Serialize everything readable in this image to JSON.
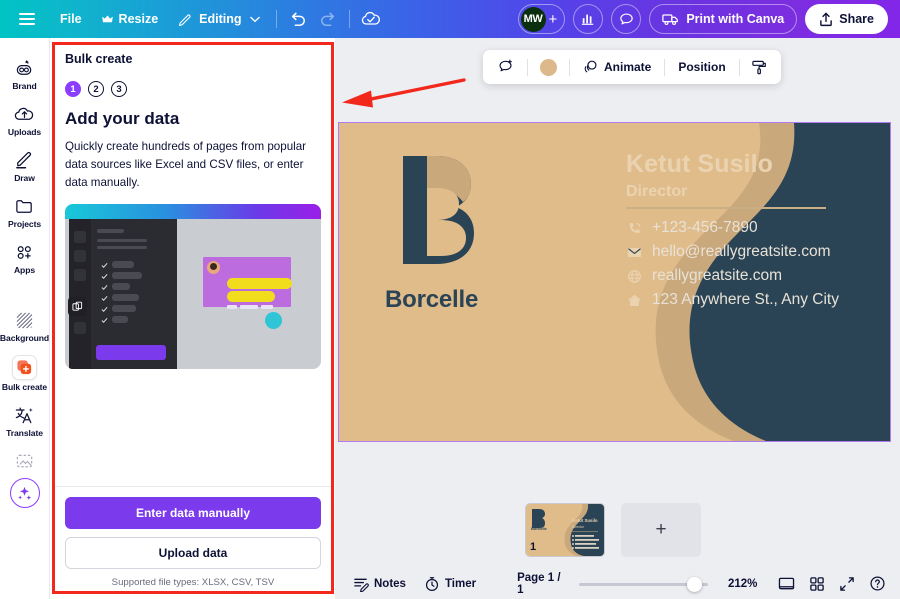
{
  "topbar": {
    "menu_icon": "hamburger-icon",
    "file": "File",
    "resize": "Resize",
    "resize_icon": "crown-icon",
    "editing": "Editing",
    "editing_icon": "pencil-icon",
    "chevron": "chevron-down-icon",
    "undo_icon": "undo-icon",
    "redo_icon": "redo-icon",
    "cloud_icon": "cloud-saved-icon",
    "avatar_initials": "MW",
    "add_member": "+",
    "insights_icon": "bar-chart-icon",
    "comments_icon": "comment-bubble-icon",
    "print_icon": "delivery-truck-icon",
    "print_label": "Print with Canva",
    "share_icon": "share-upload-icon",
    "share_label": "Share"
  },
  "rail": {
    "items": [
      {
        "label": "Brand",
        "icon": "brand-crown-icon",
        "active": false
      },
      {
        "label": "Uploads",
        "icon": "upload-cloud-icon",
        "active": false
      },
      {
        "label": "Draw",
        "icon": "pen-draw-icon",
        "active": false
      },
      {
        "label": "Projects",
        "icon": "folder-icon",
        "active": false
      },
      {
        "label": "Apps",
        "icon": "apps-grid-icon",
        "active": false
      },
      {
        "label": "Background",
        "icon": "background-hatch-icon",
        "active": false
      },
      {
        "label": "Bulk create",
        "icon": "bulk-create-icon",
        "active": true
      },
      {
        "label": "Translate",
        "icon": "translate-icon",
        "active": false
      }
    ],
    "magic_button": "magic-sparkle-icon"
  },
  "panel": {
    "title": "Bulk create",
    "steps": [
      {
        "num": "1",
        "state": "on"
      },
      {
        "num": "2",
        "state": "off"
      },
      {
        "num": "3",
        "state": "off"
      }
    ],
    "heading": "Add your data",
    "description": "Quickly create hundreds of pages from popular data sources like Excel and CSV files, or enter data manually.",
    "illustration": "bulk-create-illustration",
    "primary_button": "Enter data manually",
    "secondary_button": "Upload data",
    "support_note": "Supported file types: XLSX, CSV, TSV"
  },
  "annotation": {
    "highlight_color": "#f2281c",
    "arrow": "red-left-arrow"
  },
  "float_toolbar": {
    "comment_icon": "add-comment-icon",
    "color_swatch": "#ddb88a",
    "animate_icon": "animate-icon",
    "animate_label": "Animate",
    "position_label": "Position",
    "copy_style_icon": "paint-roller-icon"
  },
  "card": {
    "bg_color": "#e0bc8b",
    "accent_color": "#2a4456",
    "text_color": "#ead3b0",
    "brand_name": "Borcelle",
    "logo": "borcelle-b-logo",
    "person_name": "Ketut Susilo",
    "person_role": "Director",
    "contacts": [
      {
        "icon": "phone-icon",
        "value": "+123-456-7890"
      },
      {
        "icon": "mail-icon",
        "value": "hello@reallygreatsite.com"
      },
      {
        "icon": "globe-icon",
        "value": "reallygreatsite.com"
      },
      {
        "icon": "home-icon",
        "value": "123 Anywhere St., Any City"
      }
    ]
  },
  "pages": {
    "thumbnail_number": "1",
    "add_page_icon": "+"
  },
  "statusbar": {
    "notes_icon": "notes-icon",
    "notes_label": "Notes",
    "timer_icon": "timer-icon",
    "timer_label": "Timer",
    "page_label": "Page 1 / 1",
    "zoom_value": "212%",
    "page_view_icon": "single-page-view-icon",
    "grid_view_icon": "grid-view-icon",
    "fullscreen_icon": "fullscreen-icon",
    "help_icon": "help-question-icon"
  }
}
